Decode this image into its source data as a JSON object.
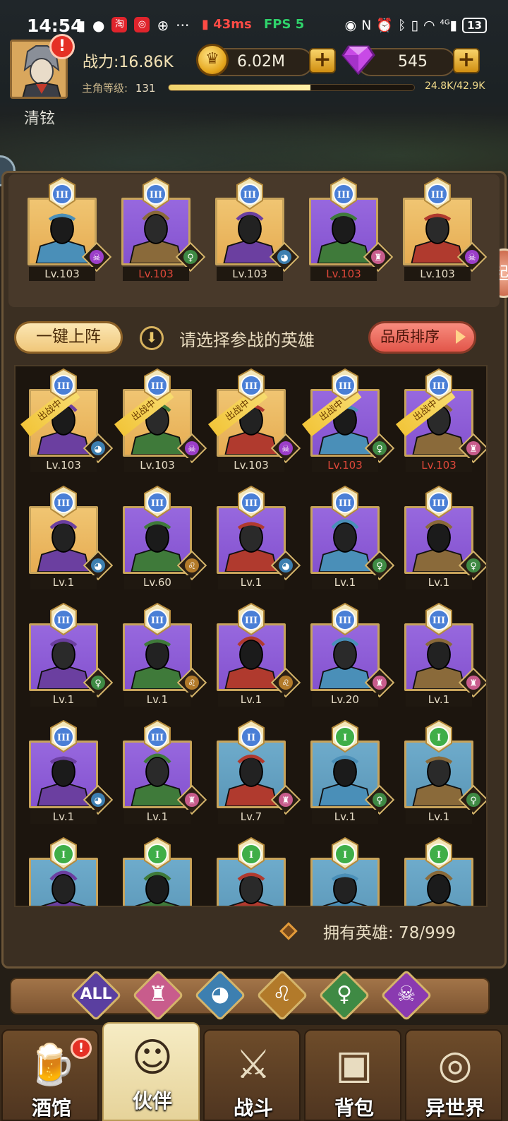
{
  "status_bar": {
    "time": "14:54",
    "ping": "43ms",
    "fps": "FPS 5",
    "battery": "13",
    "network": "4G"
  },
  "player": {
    "name": "清铉",
    "power": "战力:16.86K",
    "gold": "6.02M",
    "gems": "545",
    "level_label": "主角等级:",
    "level": "131",
    "xp_text": "24.8K/42.9K",
    "xp_fraction": 0.578
  },
  "lineup": {
    "heroes": [
      {
        "level": "Lv.103",
        "bg": "gold",
        "tier": "III",
        "faction": "demon",
        "red": false
      },
      {
        "level": "Lv.103",
        "bg": "purple",
        "tier": "III",
        "faction": "elf",
        "red": true
      },
      {
        "level": "Lv.103",
        "bg": "gold",
        "tier": "III",
        "faction": "beast",
        "red": false
      },
      {
        "level": "Lv.103",
        "bg": "purple",
        "tier": "III",
        "faction": "human",
        "red": true
      },
      {
        "level": "Lv.103",
        "bg": "gold",
        "tier": "III",
        "faction": "demon",
        "red": false
      }
    ]
  },
  "actions": {
    "auto_deploy": "一键上阵",
    "hint": "请选择参战的英雄",
    "sort": "品质排序"
  },
  "roster": {
    "deployed_label": "出战中",
    "heroes": [
      {
        "level": "Lv.103",
        "bg": "gold",
        "tier": "III",
        "faction": "beast",
        "deployed": true,
        "red": false
      },
      {
        "level": "Lv.103",
        "bg": "gold",
        "tier": "III",
        "faction": "demon",
        "deployed": true,
        "red": false
      },
      {
        "level": "Lv.103",
        "bg": "gold",
        "tier": "III",
        "faction": "demon",
        "deployed": true,
        "red": false
      },
      {
        "level": "Lv.103",
        "bg": "purple",
        "tier": "III",
        "faction": "elf",
        "deployed": true,
        "red": true
      },
      {
        "level": "Lv.103",
        "bg": "purple",
        "tier": "III",
        "faction": "human",
        "deployed": true,
        "red": true
      },
      {
        "level": "Lv.1",
        "bg": "gold",
        "tier": "III",
        "faction": "beast",
        "deployed": false,
        "red": false
      },
      {
        "level": "Lv.60",
        "bg": "purple",
        "tier": "III",
        "faction": "lion",
        "deployed": false,
        "red": false
      },
      {
        "level": "Lv.1",
        "bg": "purple",
        "tier": "III",
        "faction": "beast",
        "deployed": false,
        "red": false
      },
      {
        "level": "Lv.1",
        "bg": "purple",
        "tier": "III",
        "faction": "elf",
        "deployed": false,
        "red": false
      },
      {
        "level": "Lv.1",
        "bg": "purple",
        "tier": "III",
        "faction": "elf",
        "deployed": false,
        "red": false
      },
      {
        "level": "Lv.1",
        "bg": "purple",
        "tier": "III",
        "faction": "elf",
        "deployed": false,
        "red": false
      },
      {
        "level": "Lv.1",
        "bg": "purple",
        "tier": "III",
        "faction": "lion",
        "deployed": false,
        "red": false
      },
      {
        "level": "Lv.1",
        "bg": "purple",
        "tier": "III",
        "faction": "lion",
        "deployed": false,
        "red": false
      },
      {
        "level": "Lv.20",
        "bg": "purple",
        "tier": "III",
        "faction": "human",
        "deployed": false,
        "red": false
      },
      {
        "level": "Lv.1",
        "bg": "purple",
        "tier": "III",
        "faction": "human",
        "deployed": false,
        "red": false
      },
      {
        "level": "Lv.1",
        "bg": "purple",
        "tier": "III",
        "faction": "beast",
        "deployed": false,
        "red": false
      },
      {
        "level": "Lv.1",
        "bg": "purple",
        "tier": "III",
        "faction": "human",
        "deployed": false,
        "red": false
      },
      {
        "level": "Lv.7",
        "bg": "blue",
        "tier": "II",
        "faction": "human",
        "deployed": false,
        "red": false
      },
      {
        "level": "Lv.1",
        "bg": "blue",
        "tier": "I",
        "faction": "elf",
        "deployed": false,
        "red": false
      },
      {
        "level": "Lv.1",
        "bg": "blue",
        "tier": "I",
        "faction": "elf",
        "deployed": false,
        "red": false
      },
      {
        "level": "",
        "bg": "blue",
        "tier": "I",
        "faction": "",
        "deployed": false,
        "red": false
      },
      {
        "level": "",
        "bg": "blue",
        "tier": "I",
        "faction": "",
        "deployed": false,
        "red": false
      },
      {
        "level": "",
        "bg": "blue",
        "tier": "I",
        "faction": "",
        "deployed": false,
        "red": false
      },
      {
        "level": "",
        "bg": "blue",
        "tier": "I",
        "faction": "",
        "deployed": false,
        "red": false
      },
      {
        "level": "",
        "bg": "blue",
        "tier": "I",
        "faction": "",
        "deployed": false,
        "red": false
      }
    ]
  },
  "owned_heroes": "拥有英雄: 78/999",
  "filters": [
    {
      "label": "ALL",
      "icon": "all-icon",
      "color": "#5a3fa0"
    },
    {
      "label": "",
      "icon": "human-faction-icon",
      "color": "#c85c8c"
    },
    {
      "label": "",
      "icon": "beast-faction-icon",
      "color": "#3d7fb0"
    },
    {
      "label": "",
      "icon": "lion-faction-icon",
      "color": "#b27a2a"
    },
    {
      "label": "",
      "icon": "elf-faction-icon",
      "color": "#3f8a44"
    },
    {
      "label": "",
      "icon": "demon-faction-icon",
      "color": "#8a3ab0"
    }
  ],
  "nav": [
    {
      "label": "酒馆",
      "icon": "tavern-mug-icon",
      "badge": true
    },
    {
      "label": "伙伴",
      "icon": "partner-icon",
      "badge": false,
      "active": true
    },
    {
      "label": "战斗",
      "icon": "battle-swords-icon",
      "badge": false
    },
    {
      "label": "背包",
      "icon": "backpack-chest-icon",
      "badge": false
    },
    {
      "label": "异世界",
      "icon": "portal-icon",
      "badge": false
    }
  ],
  "colors": {
    "tier_III": "#4a7fd6",
    "tier_II": "#4a7fd6",
    "tier_I": "#3fae48",
    "level_red": "#e0483a",
    "level_normal": "#e6dcc6"
  }
}
